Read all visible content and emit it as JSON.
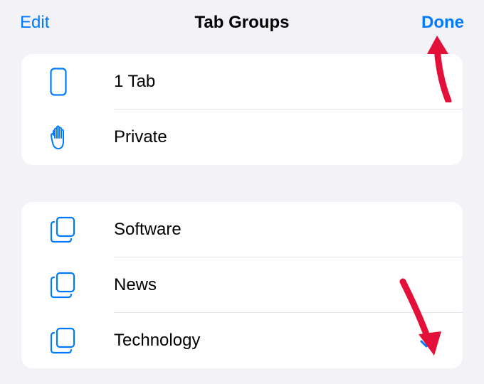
{
  "header": {
    "edit_label": "Edit",
    "title": "Tab Groups",
    "done_label": "Done"
  },
  "colors": {
    "accent": "#007aff",
    "arrow": "#e3103a"
  },
  "sections": [
    {
      "rows": [
        {
          "icon": "device-iphone-icon",
          "label": "1 Tab",
          "selected": false
        },
        {
          "icon": "hand-raised-icon",
          "label": "Private",
          "selected": false
        }
      ]
    },
    {
      "rows": [
        {
          "icon": "square-on-square-icon",
          "label": "Software",
          "selected": false
        },
        {
          "icon": "square-on-square-icon",
          "label": "News",
          "selected": false
        },
        {
          "icon": "square-on-square-icon",
          "label": "Technology",
          "selected": true
        }
      ]
    }
  ]
}
